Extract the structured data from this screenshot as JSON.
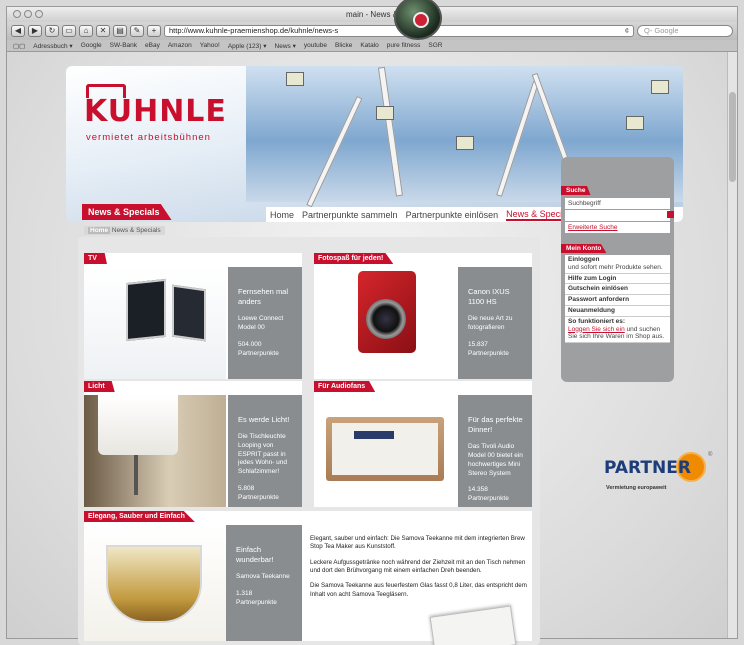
{
  "window": {
    "title": "main - News &"
  },
  "toolbar": {
    "url": "http://www.kuhnle-praemienshop.de/kuhnle/news-s",
    "search_placeholder": "Q- Google"
  },
  "bookmarks": [
    "Adressbuch ▾",
    "Google",
    "SW-Bank",
    "eBay",
    "Amazon",
    "Yahoo!",
    "Apple (123) ▾",
    "News ▾",
    "youtube",
    "Blicke",
    "Katalo",
    "pure fitness",
    "SGR"
  ],
  "brand": {
    "logo": "KUHNLE",
    "tagline": "vermietet arbeitsbühnen"
  },
  "nav": {
    "items": [
      "Home",
      "Partnerpunkte sammeln",
      "Partnerpunkte einlösen",
      "News & Specials"
    ],
    "active": "News & Specials"
  },
  "page_tab": "News & Specials",
  "breadcrumb": {
    "home": "Home",
    "current": "News & Specials"
  },
  "cards": [
    {
      "tag": "TV",
      "title": "Fernsehen mal anders",
      "desc": "Loewe Connect Model 00",
      "points": "504.000 Partnerpunkte"
    },
    {
      "tag": "Fotospaß für jeden!",
      "title": "Canon IXUS 1100 HS",
      "desc": "Die neue Art zu fotografieren",
      "points": "15.837 Partnerpunkte"
    },
    {
      "tag": "Licht",
      "title": "Es werde Licht!",
      "desc": "Die Tischleuchte Looping von ESPRIT passt in jedes Wohn- und Schlafzimmer!",
      "points": "5.808 Partnerpunkte"
    },
    {
      "tag": "Für Audiofans",
      "title": "Für das perfekte Dinner!",
      "desc": "Das Tivoli Audio Model 00 bietet ein hochwertiges Mini Stereo System",
      "points": "14.358 Partnerpunkte"
    },
    {
      "tag": "Elegang, Sauber und Einfach",
      "title": "Einfach wunderbar!",
      "desc": "Samova Teekanne",
      "points": "1.318 Partnerpunkte"
    }
  ],
  "article": [
    "Elegant, sauber und einfach: Die Samova Teekanne mit dem integrierten Brew Stop Tea Maker aus Kunststoff.",
    "Leckere Aufgussgetränke noch während der Ziehzeit mit an den Tisch nehmen und dort den Brühvorgang mit einem einfachen Dreh beenden.",
    "Die Samova Teekanne aus feuerfestem Glas fasst 0,8 Liter, das entspricht dem Inhalt von acht Samova Teegläsern."
  ],
  "sidebar": {
    "search_tab": "Suche",
    "search_placeholder": "Suchbegriff",
    "advanced_search": "Erweiterte Suche",
    "account_tab": "Mein Konto",
    "login_title": "Einloggen",
    "login_desc": "und sofort mehr Produkte sehen.",
    "help_login": "Hilfe zum Login",
    "voucher": "Gutschein einlösen",
    "password": "Passwort anfordern",
    "register": "Neuanmeldung",
    "how_title": "So funktioniert es:",
    "how_link": "Loggen Sie sich ein",
    "how_desc": "und suchen Sie sich Ihre Waren im Shop aus."
  },
  "partner": {
    "word": "PARTNER",
    "sub": "Vermietung europaweit",
    "reg": "®"
  }
}
